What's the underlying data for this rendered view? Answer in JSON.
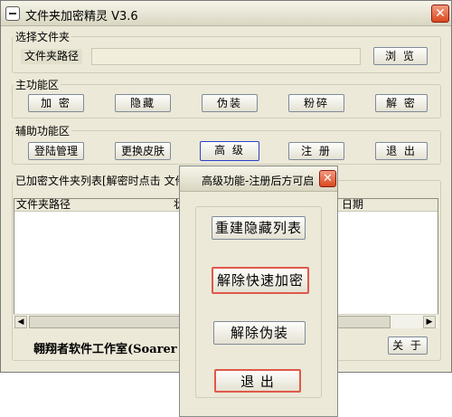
{
  "window": {
    "title": "文件夹加密精灵 V3.6"
  },
  "select_group": {
    "label": "选择文件夹",
    "path_label": "文件夹路径",
    "path_value": "",
    "browse": "浏 览"
  },
  "main_group": {
    "label": "主功能区",
    "buttons": [
      "加 密",
      "隐藏",
      "伪装",
      "粉碎",
      "解 密"
    ]
  },
  "aux_group": {
    "label": "辅助功能区",
    "buttons": [
      "登陆管理",
      "更换皮肤",
      "高 级",
      "注 册",
      "退 出"
    ]
  },
  "list_group": {
    "label": "已加密文件夹列表[解密时点击 文件",
    "col1": "文件夹路径",
    "col2": "状",
    "col3": "日期"
  },
  "footer": {
    "studio": "翱翔者软件工作室(Soarer",
    "about": "关 于"
  },
  "dialog": {
    "title": "高级功能-注册后方可启",
    "buttons": [
      "重建隐藏列表",
      "解除快速加密",
      "解除伪装",
      "退 出"
    ]
  }
}
